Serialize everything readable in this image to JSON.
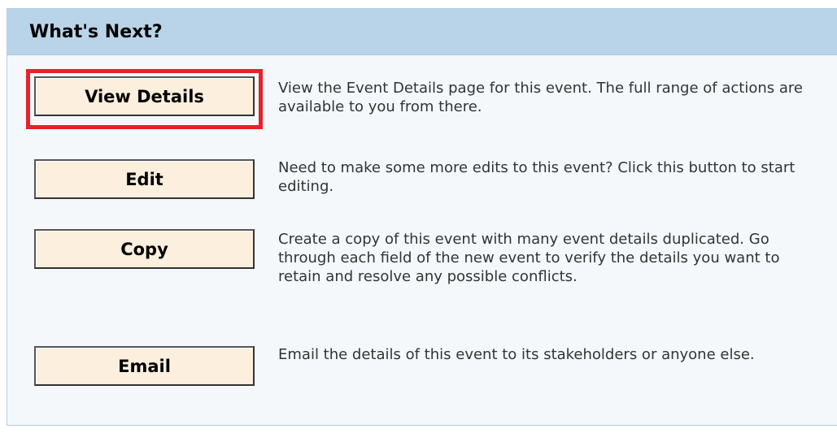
{
  "panel": {
    "title": "What's Next?"
  },
  "actions": [
    {
      "label": "View Details",
      "description": "View the Event Details page for this event. The full range of actions are available to you from there."
    },
    {
      "label": "Edit",
      "description": "Need to make some more edits to this event? Click this button to start editing."
    },
    {
      "label": "Copy",
      "description": "Create a copy of this event with many event details duplicated. Go through each field of the new event to verify the details you want to retain and resolve any possible conflicts."
    },
    {
      "label": "Email",
      "description": "Email the details of this event to its stakeholders or anyone else."
    }
  ],
  "colors": {
    "header_bg": "#b9d4e8",
    "panel_bg": "#f4f8fb",
    "button_bg": "#fcefdd",
    "highlight": "#e8202a"
  }
}
